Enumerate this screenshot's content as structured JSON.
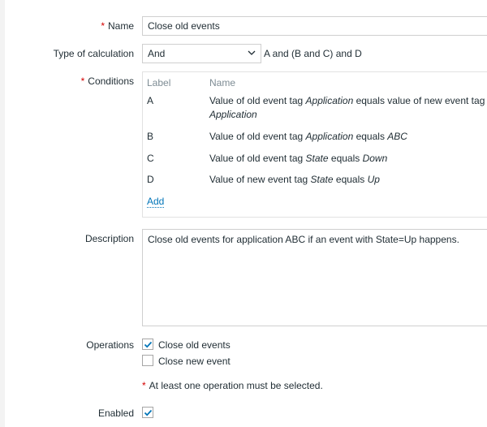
{
  "form": {
    "name": {
      "label": "Name",
      "value": "Close old events"
    },
    "type_of_calculation": {
      "label": "Type of calculation",
      "selected": "And",
      "expression": "A and (B and C) and D"
    },
    "conditions": {
      "label": "Conditions",
      "header_label": "Label",
      "header_name": "Name",
      "rows": [
        {
          "label": "A",
          "text_1": "Value of old event tag ",
          "italic_1": "Application",
          "text_2": " equals value of new event tag",
          "italic_2": "Application"
        },
        {
          "label": "B",
          "text_1": "Value of old event tag ",
          "italic_1": "Application",
          "text_2": " equals ",
          "italic_2": "ABC"
        },
        {
          "label": "C",
          "text_1": "Value of old event tag ",
          "italic_1": "State",
          "text_2": " equals ",
          "italic_2": "Down"
        },
        {
          "label": "D",
          "text_1": "Value of new event tag ",
          "italic_1": "State",
          "text_2": " equals ",
          "italic_2": "Up"
        }
      ],
      "add_link": "Add"
    },
    "description": {
      "label": "Description",
      "value": "Close old events for application ABC if an event with State=Up happens."
    },
    "operations": {
      "label": "Operations",
      "items": [
        {
          "label": "Close old events",
          "checked": true
        },
        {
          "label": "Close new event",
          "checked": false
        }
      ],
      "hint": "At least one operation must be selected."
    },
    "enabled": {
      "label": "Enabled",
      "checked": true
    },
    "required_marker": "*"
  },
  "colors": {
    "required": "#d40000",
    "link": "#0275b8",
    "check": "#0275b8",
    "muted": "#7e8c94"
  }
}
